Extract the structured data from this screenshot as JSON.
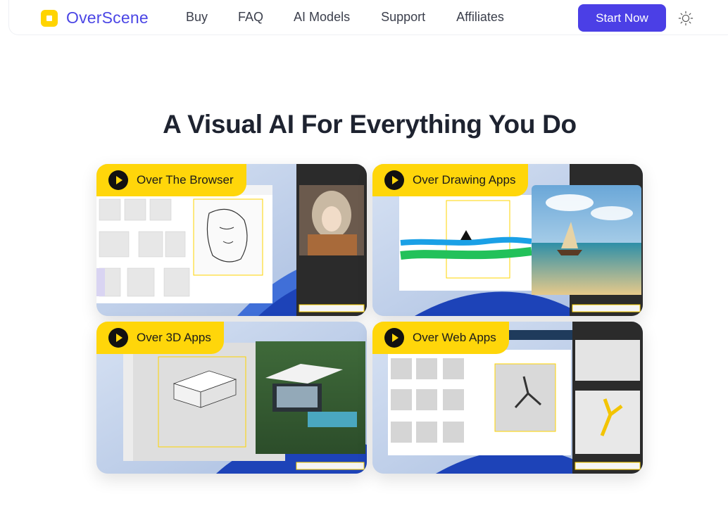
{
  "brand": {
    "name": "OverScene"
  },
  "nav": {
    "items": [
      "Buy",
      "FAQ",
      "AI Models",
      "Support",
      "Affiliates"
    ]
  },
  "cta": {
    "label": "Start Now"
  },
  "hero": {
    "title": "A Visual AI For Everything You Do"
  },
  "cards": [
    {
      "label": "Over The Browser"
    },
    {
      "label": "Over Drawing Apps"
    },
    {
      "label": "Over 3D Apps"
    },
    {
      "label": "Over Web Apps"
    }
  ],
  "colors": {
    "accent": "#4b3fe6",
    "brand_text": "#4b46e5",
    "tag_yellow": "#ffd60a"
  },
  "icons": {
    "theme": "sun-icon",
    "play": "play-icon"
  }
}
